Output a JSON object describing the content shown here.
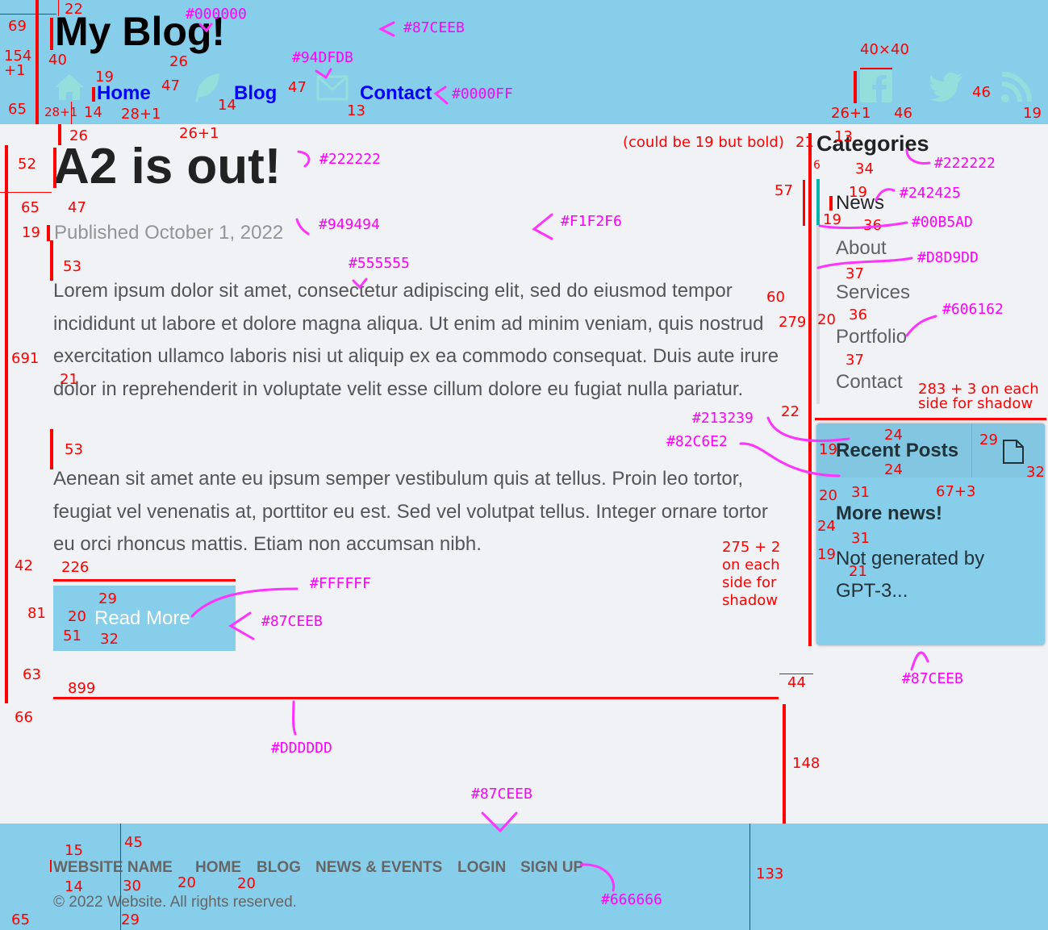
{
  "header": {
    "title": "My Blog!",
    "nav": [
      {
        "label": "Home",
        "icon": "home-icon"
      },
      {
        "label": "Blog",
        "icon": "feather-icon"
      },
      {
        "label": "Contact",
        "icon": "envelope-icon"
      }
    ],
    "social": [
      "facebook-icon",
      "twitter-icon",
      "rss-icon"
    ]
  },
  "post": {
    "title": "A2 is out!",
    "published": "Published October 1, 2022",
    "paragraphs": [
      "Lorem ipsum dolor sit amet, consectetur adipiscing elit, sed do eiusmod tempor incididunt ut labore et dolore magna aliqua. Ut enim ad minim veniam, quis nostrud exercitation ullamco laboris nisi ut aliquip ex ea commodo consequat. Duis aute irure dolor in reprehenderit in voluptate velit esse cillum dolore eu fugiat nulla pariatur.",
      "Aenean sit amet ante eu ipsum semper vestibulum quis at tellus. Proin leo tortor, feugiat vel venenatis at, porttitor eu est. Sed vel volutpat tellus. Integer ornare tortor eu orci rhoncus mattis. Etiam non accumsan nibh."
    ],
    "read_more": "Read More"
  },
  "sidebar": {
    "categories_title": "Categories",
    "categories": [
      "News",
      "About",
      "Services",
      "Portfolio",
      "Contact"
    ],
    "recent_title": "Recent Posts",
    "recent_item_title": "More news!",
    "recent_item_body": "Not generated by GPT-3..."
  },
  "footer": {
    "links": [
      "WEBSITE NAME",
      "HOME",
      "BLOG",
      "NEWS & EVENTS",
      "LOGIN",
      "SIGN UP"
    ],
    "copyright": "© 2022 Website. All rights reserved."
  },
  "annotations": {
    "magenta": [
      "#000000",
      "#87CEEB",
      "#94DFDB",
      "#0000FF",
      "#222222",
      "#949494",
      "#F1F2F6",
      "#555555",
      "#FFFFFF",
      "#87CEEB",
      "#222222",
      "#242425",
      "#00B5AD",
      "#D8D9DD",
      "#606162",
      "#213239",
      "#82C6E2",
      "#87CEEB",
      "#DDDDDD",
      "#87CEEB",
      "#666666"
    ],
    "red": [
      "22",
      "69",
      "154 +1",
      "40",
      "65",
      "19",
      "47",
      "26",
      "47",
      "14",
      "28+1",
      "14",
      "28+1",
      "26+1",
      "13",
      "26",
      "40×40",
      "26+1",
      "46",
      "46",
      "19",
      "13",
      "(could be 19 but bold)",
      "21",
      "34",
      "6",
      "52",
      "65",
      "47",
      "19",
      "53",
      "691",
      "21",
      "53",
      "42",
      "226",
      "81",
      "29",
      "20",
      "51",
      "32",
      "63",
      "66",
      "899",
      "57",
      "19",
      "19",
      "36",
      "37",
      "60",
      "279",
      "20",
      "36",
      "37",
      "283 + 3 on each side for shadow",
      "22",
      "24",
      "29",
      "19",
      "24",
      "32",
      "20",
      "31",
      "67+3",
      "24",
      "31",
      "19",
      "21",
      "275 + 2 on each side for shadow",
      "44",
      "148",
      "133",
      "15",
      "45",
      "30",
      "20",
      "20",
      "14",
      "65",
      "29"
    ]
  }
}
